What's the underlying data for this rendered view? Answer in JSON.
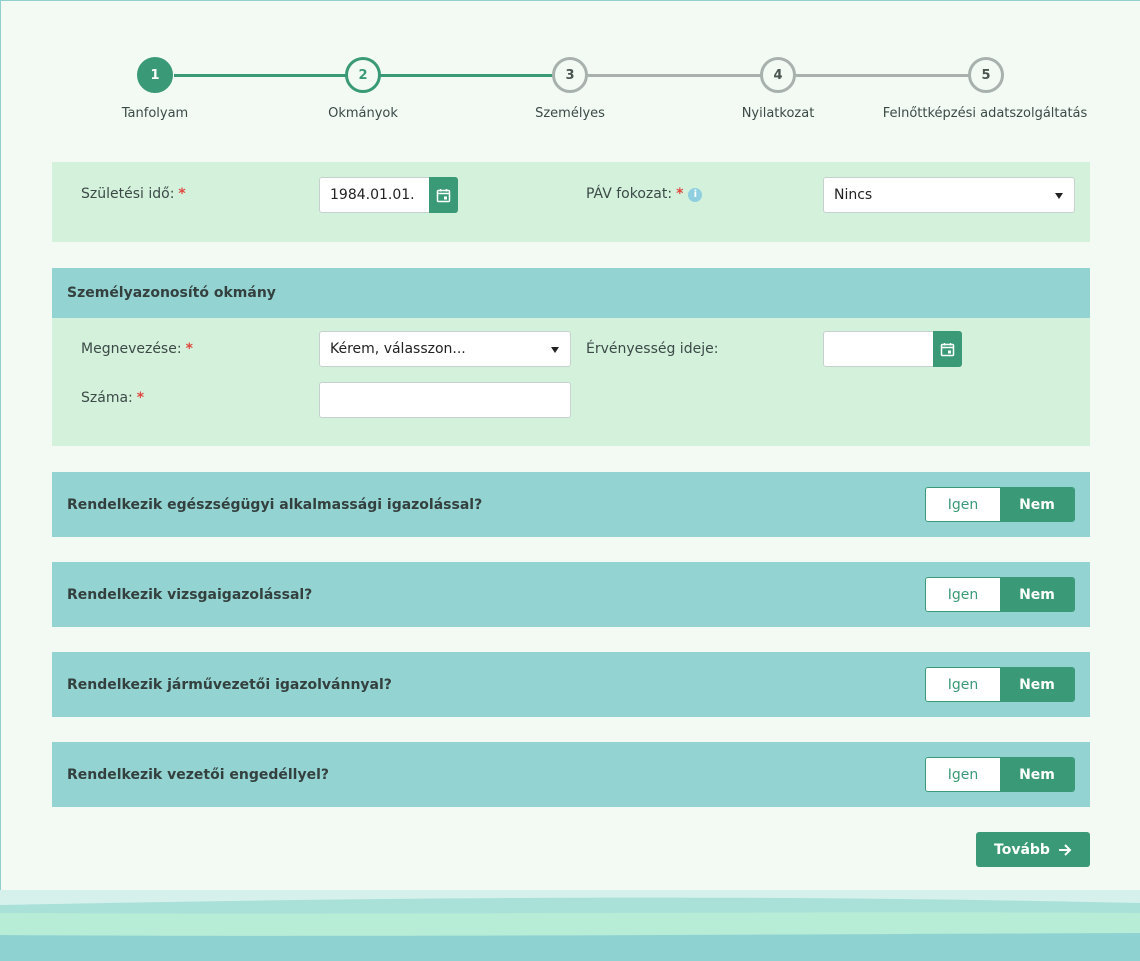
{
  "stepper": {
    "steps": [
      {
        "number": "1",
        "label": "Tanfolyam"
      },
      {
        "number": "2",
        "label": "Okmányok"
      },
      {
        "number": "3",
        "label": "Személyes"
      },
      {
        "number": "4",
        "label": "Nyilatkozat"
      },
      {
        "number": "5",
        "label": "Felnőttképzési adatszolgáltatás"
      }
    ]
  },
  "personal": {
    "birth_label": "Születési idő:",
    "birth_value": "1984.01.01.",
    "pav_label": "PÁV fokozat:",
    "pav_value": "Nincs",
    "required_mark": "*",
    "info_mark": "i"
  },
  "id_doc": {
    "title": "Személyazonosító okmány",
    "name_label": "Megnevezése:",
    "name_value": "Kérem, válasszon...",
    "validity_label": "Érvényesség ideje:",
    "number_label": "Száma:"
  },
  "questions": [
    {
      "text": "Rendelkezik egészségügyi alkalmassági igazolással?",
      "yes": "Igen",
      "no": "Nem"
    },
    {
      "text": "Rendelkezik vizsgaigazolással?",
      "yes": "Igen",
      "no": "Nem"
    },
    {
      "text": "Rendelkezik járművezetői igazolvánnyal?",
      "yes": "Igen",
      "no": "Nem"
    },
    {
      "text": "Rendelkezik vezetői engedéllyel?",
      "yes": "Igen",
      "no": "Nem"
    }
  ],
  "next_label": "Tovább",
  "colors": {
    "accent": "#3a9a77",
    "panel": "#d4f1dc",
    "header": "#93d4d3",
    "required": "#e0473f"
  }
}
